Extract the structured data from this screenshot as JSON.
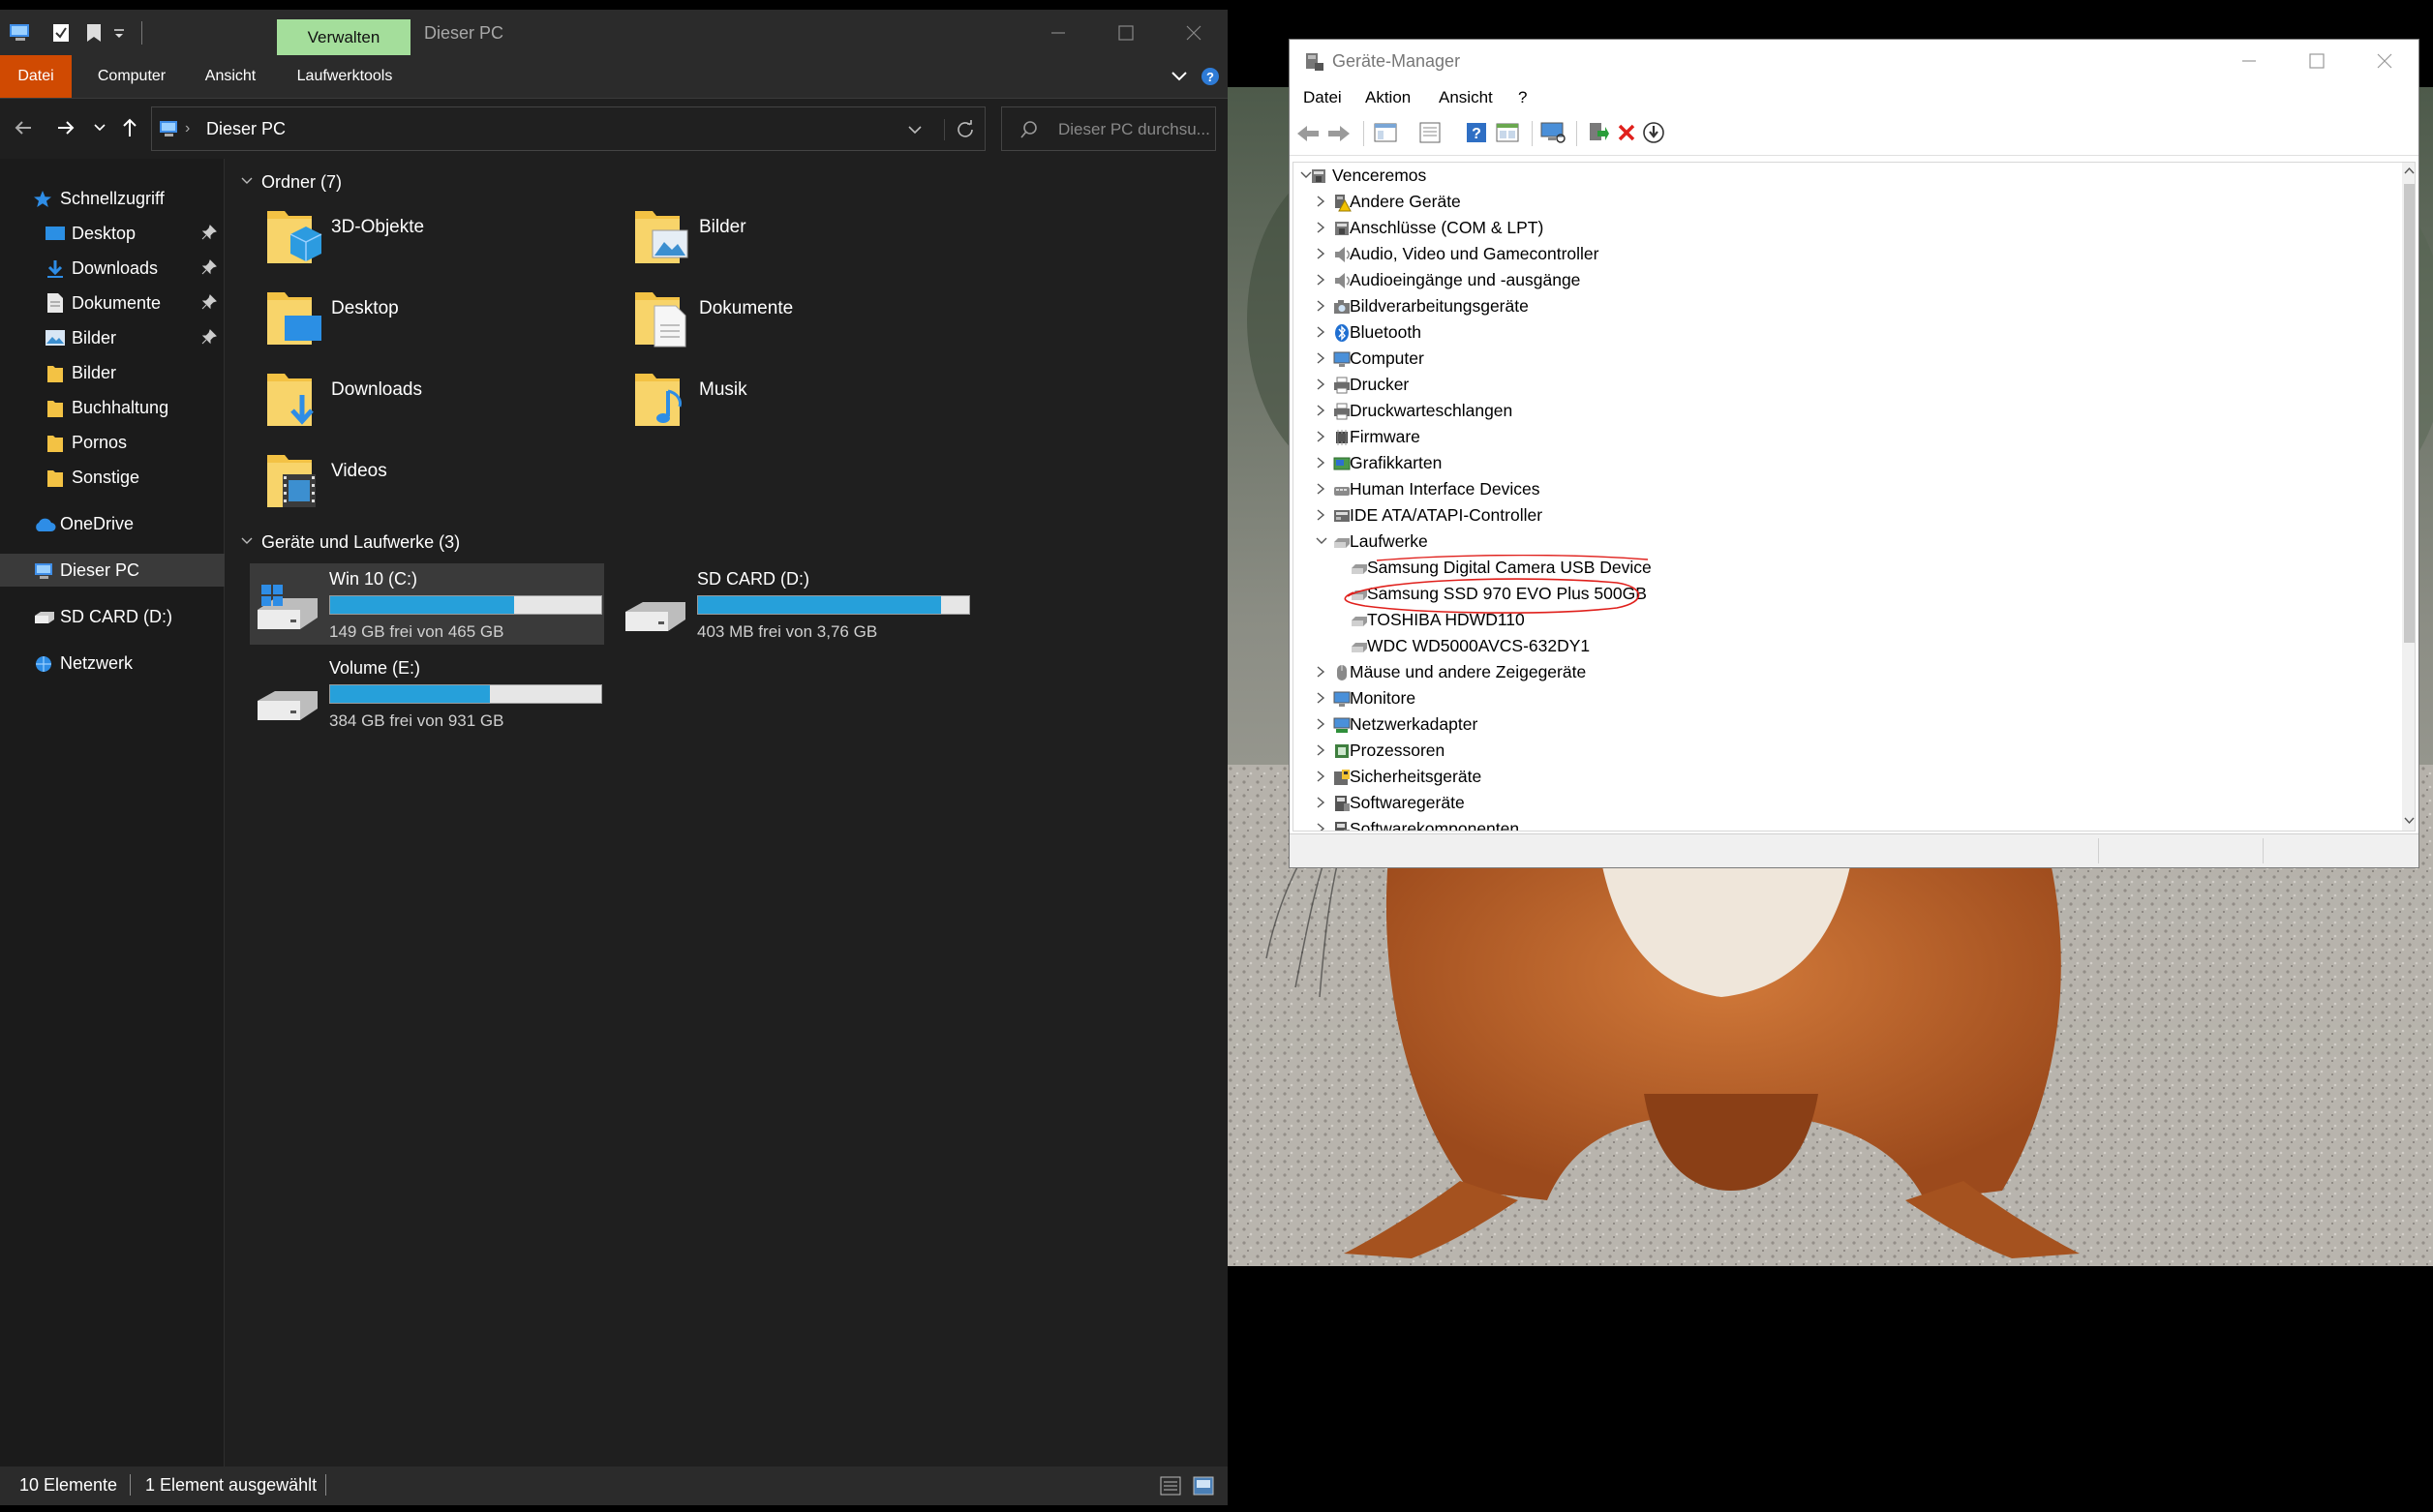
{
  "explorer": {
    "ribbon_context_tab": "Verwalten",
    "window_title": "Dieser PC",
    "menu": [
      "Datei",
      "Computer",
      "Ansicht",
      "Laufwerktools"
    ],
    "address": "Dieser PC",
    "search_placeholder": "Dieser PC durchsu...",
    "nav": {
      "quick_access": "Schnellzugriff",
      "quick_items": [
        {
          "label": "Desktop",
          "pinned": true
        },
        {
          "label": "Downloads",
          "pinned": true
        },
        {
          "label": "Dokumente",
          "pinned": true
        },
        {
          "label": "Bilder",
          "pinned": true
        },
        {
          "label": "Bilder",
          "pinned": false
        },
        {
          "label": "Buchhaltung",
          "pinned": false
        },
        {
          "label": "Pornos",
          "pinned": false
        },
        {
          "label": "Sonstige",
          "pinned": false
        }
      ],
      "onedrive": "OneDrive",
      "this_pc": "Dieser PC",
      "sd_card": "SD CARD (D:)",
      "network": "Netzwerk"
    },
    "folders_header": "Ordner (7)",
    "folders": [
      "3D-Objekte",
      "Bilder",
      "Desktop",
      "Dokumente",
      "Downloads",
      "Musik",
      "Videos"
    ],
    "drives_header": "Geräte und Laufwerke (3)",
    "drives": [
      {
        "name": "Win 10 (C:)",
        "free_text": "149 GB frei von 465 GB",
        "used_fraction": 0.68,
        "selected": true
      },
      {
        "name": "SD CARD (D:)",
        "free_text": "403 MB frei von 3,76 GB",
        "used_fraction": 0.895,
        "selected": false
      },
      {
        "name": "Volume (E:)",
        "free_text": "384 GB frei von 931 GB",
        "used_fraction": 0.59,
        "selected": false
      }
    ],
    "status": {
      "count": "10 Elemente",
      "selection": "1 Element ausgewählt"
    }
  },
  "device_manager": {
    "title": "Geräte-Manager",
    "menu": [
      "Datei",
      "Aktion",
      "Ansicht",
      "?"
    ],
    "root": "Venceremos",
    "categories": [
      {
        "label": "Andere Geräte",
        "icon": "warning-device-icon"
      },
      {
        "label": "Anschlüsse (COM & LPT)",
        "icon": "port-icon"
      },
      {
        "label": "Audio, Video und Gamecontroller",
        "icon": "speaker-icon"
      },
      {
        "label": "Audioeingänge und -ausgänge",
        "icon": "speaker-icon"
      },
      {
        "label": "Bildverarbeitungsgeräte",
        "icon": "camera-icon"
      },
      {
        "label": "Bluetooth",
        "icon": "bluetooth-icon"
      },
      {
        "label": "Computer",
        "icon": "monitor-icon"
      },
      {
        "label": "Drucker",
        "icon": "printer-icon"
      },
      {
        "label": "Druckwarteschlangen",
        "icon": "printer-icon"
      },
      {
        "label": "Firmware",
        "icon": "chip-icon"
      },
      {
        "label": "Grafikkarten",
        "icon": "display-adapter-icon"
      },
      {
        "label": "Human Interface Devices",
        "icon": "hid-icon"
      },
      {
        "label": "IDE ATA/ATAPI-Controller",
        "icon": "controller-icon"
      },
      {
        "label": "Laufwerke",
        "icon": "disk-icon",
        "expanded": true
      },
      {
        "label": "Mäuse und andere Zeigegeräte",
        "icon": "mouse-icon"
      },
      {
        "label": "Monitore",
        "icon": "monitor-icon"
      },
      {
        "label": "Netzwerkadapter",
        "icon": "network-icon"
      },
      {
        "label": "Prozessoren",
        "icon": "cpu-icon"
      },
      {
        "label": "Sicherheitsgeräte",
        "icon": "security-icon"
      },
      {
        "label": "Softwaregeräte",
        "icon": "software-icon"
      },
      {
        "label": "Softwarekomponenten",
        "icon": "software-icon"
      }
    ],
    "disk_children": [
      "Samsung Digital Camera USB Device",
      "Samsung SSD 970 EVO Plus 500GB",
      "TOSHIBA HDWD110",
      "WDC WD5000AVCS-632DY1"
    ],
    "highlighted_child": "Samsung SSD 970 EVO Plus 500GB",
    "annotation_color": "#e0201c"
  },
  "colors": {
    "accent": "#26a0da",
    "ribbon_green": "#a4de9b",
    "datei_orange": "#d04a02"
  }
}
